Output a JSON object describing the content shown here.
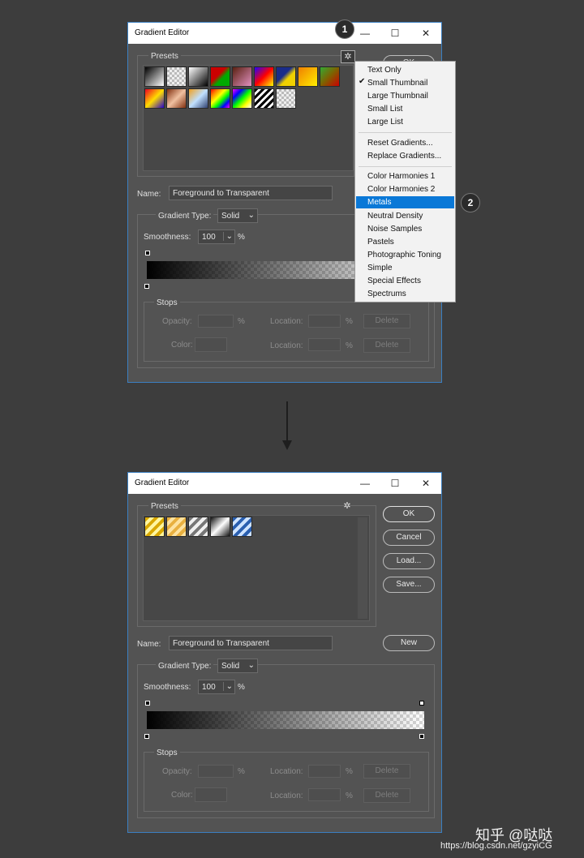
{
  "top": {
    "title": "Gradient Editor",
    "presets_label": "Presets",
    "partial_ok_label": "OK",
    "name_label": "Name:",
    "name_value": "Foreground to Transparent",
    "gradient_type_label": "Gradient Type:",
    "gradient_type_value": "Solid",
    "smoothness_label": "Smoothness:",
    "smoothness_value": "100",
    "percent": "%",
    "stops_label": "Stops",
    "opacity_label": "Opacity:",
    "color_label": "Color:",
    "location_label": "Location:",
    "delete_label": "Delete",
    "swatches": [
      "#000-#fff",
      "transparent",
      "#fff-#000",
      "#c00-#0a0",
      "#704020-#e090c0",
      "#20f-#f00",
      "#1a2c8a-#f0d000",
      "#f0a000-#ffee00",
      "#3a3-#c00",
      "#e02-#fd0",
      "#a04020-#f0c0a0",
      "#c0e0ff-#304070",
      "rainbow",
      "rainbow-trans",
      "stripes",
      "transparent"
    ]
  },
  "menu": {
    "items": [
      "Text Only",
      "Small Thumbnail",
      "Large Thumbnail",
      "Small List",
      "Large List",
      "Reset Gradients...",
      "Replace Gradients...",
      "Color Harmonies 1",
      "Color Harmonies 2",
      "Metals",
      "Neutral Density",
      "Noise Samples",
      "Pastels",
      "Photographic Toning",
      "Simple",
      "Special Effects",
      "Spectrums"
    ],
    "checked": "Small Thumbnail",
    "selected": "Metals"
  },
  "badges": [
    "1",
    "2"
  ],
  "bottom": {
    "title": "Gradient Editor",
    "presets_label": "Presets",
    "ok_label": "OK",
    "cancel_label": "Cancel",
    "load_label": "Load...",
    "save_label": "Save...",
    "new_label": "New",
    "name_label": "Name:",
    "name_value": "Foreground to Transparent",
    "gradient_type_label": "Gradient Type:",
    "gradient_type_value": "Solid",
    "smoothness_label": "Smoothness:",
    "smoothness_value": "100",
    "percent": "%",
    "stops_label": "Stops",
    "opacity_label": "Opacity:",
    "color_label": "Color:",
    "location_label": "Location:",
    "delete_label": "Delete",
    "metal_swatches": [
      "gold",
      "gold-light",
      "silver",
      "silver-dark",
      "blue-steel"
    ]
  },
  "watermark": {
    "brand": "知乎 @哒哒",
    "url": "https://blog.csdn.net/gzyiCG"
  },
  "colors": {
    "accent": "#0a78d7",
    "dialog_bg": "#535353",
    "page_bg": "#3d3d3d",
    "border_accent": "#3b7fc1"
  }
}
